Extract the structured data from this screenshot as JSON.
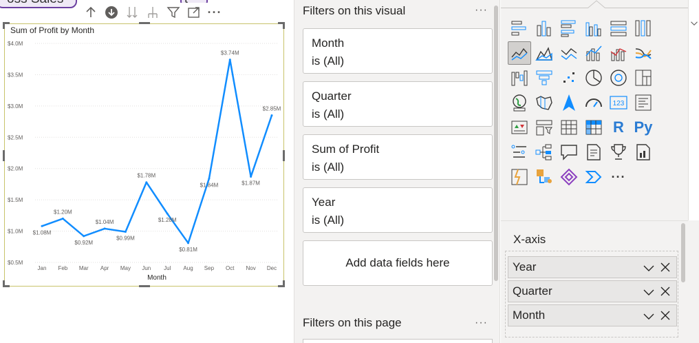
{
  "canvas": {
    "partial_card_text": "oss Sales",
    "partial_card2_text": "t"
  },
  "visual": {
    "title": "Sum of Profit by Month",
    "toolbar": {
      "icons": [
        "arrow-up-icon",
        "drill-down-circle-icon",
        "expand-all-down-icon",
        "expand-hierarchy-icon",
        "filter-icon",
        "focus-mode-icon",
        "more-options-icon"
      ],
      "more_label": "···"
    }
  },
  "chart_data": {
    "type": "line",
    "title": "Sum of Profit by Month",
    "xlabel": "Month",
    "ylabel": "",
    "categories": [
      "Jan",
      "Feb",
      "Mar",
      "Apr",
      "May",
      "Jun",
      "Jul",
      "Aug",
      "Sep",
      "Oct",
      "Nov",
      "Dec"
    ],
    "series": [
      {
        "values": [
          1.08,
          1.2,
          0.92,
          1.04,
          0.99,
          1.78,
          1.28,
          0.81,
          1.84,
          3.74,
          1.87,
          2.85
        ],
        "labels": [
          "$1.08M",
          "$1.20M",
          "$0.92M",
          "$1.04M",
          "$0.99M",
          "$1.78M",
          "$1.28M",
          "$0.81M",
          "$1.84M",
          "$3.74M",
          "$1.87M",
          "$2.85M"
        ],
        "color": "#118dff"
      }
    ],
    "yticks": [
      "$0.5M",
      "$1.0M",
      "$1.5M",
      "$2.0M",
      "$2.5M",
      "$3.0M",
      "$3.5M",
      "$4.0M"
    ],
    "ytick_values": [
      0.5,
      1.0,
      1.5,
      2.0,
      2.5,
      3.0,
      3.5,
      4.0
    ],
    "ylim": [
      0.5,
      4.0
    ],
    "grid": true,
    "legend": "none"
  },
  "filters_pane": {
    "header": "Filters on this visual",
    "more_label": "···",
    "cards": [
      {
        "name": "Month",
        "value": "is (All)"
      },
      {
        "name": "Quarter",
        "value": "is (All)"
      },
      {
        "name": "Sum of Profit",
        "value": "is (All)"
      },
      {
        "name": "Year",
        "value": "is (All)"
      }
    ],
    "add_label": "Add data fields here",
    "page_header": "Filters on this page"
  },
  "viz_pane": {
    "icons": [
      "stacked-bar-chart-icon",
      "stacked-column-chart-icon",
      "clustered-bar-chart-icon",
      "clustered-column-chart-icon",
      "100-stacked-bar-chart-icon",
      "100-stacked-column-chart-icon",
      "line-chart-icon",
      "area-chart-icon",
      "stacked-area-chart-icon",
      "line-and-stacked-column-icon",
      "line-and-clustered-column-icon",
      "ribbon-chart-icon",
      "waterfall-chart-icon",
      "funnel-chart-icon",
      "scatter-chart-icon",
      "pie-chart-icon",
      "donut-chart-icon",
      "treemap-icon",
      "map-icon",
      "filled-map-icon",
      "azure-map-icon",
      "gauge-icon",
      "card-icon",
      "multi-row-card-icon",
      "kpi-icon",
      "slicer-icon",
      "table-icon",
      "matrix-icon",
      "r-visual-icon",
      "python-visual-icon",
      "key-influencers-icon",
      "decomposition-tree-icon",
      "qa-icon",
      "smart-narrative-icon",
      "goals-icon",
      "paginated-report-icon",
      "power-apps-icon",
      "power-automate-icon",
      "custom-visual-icon",
      "get-more-visuals-icon",
      "more-visuals-icon"
    ],
    "r_label": "R",
    "py_label": "Py",
    "card_label": "123",
    "more_label": "···",
    "xaxis_label": "X-axis",
    "fields": [
      "Year",
      "Quarter",
      "Month"
    ]
  }
}
